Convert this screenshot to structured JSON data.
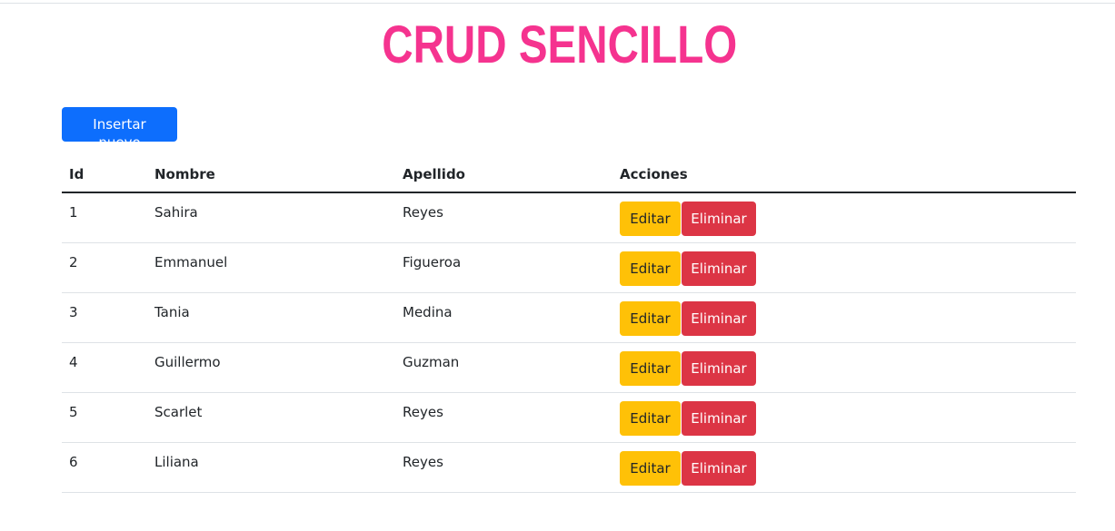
{
  "title": "CRUD SENCILLO",
  "colors": {
    "title": "#f5338f",
    "primary": "#0d6efd",
    "warning": "#ffc107",
    "danger": "#dc3545"
  },
  "insert_button": "Insertar nuevo",
  "table": {
    "headers": {
      "id": "Id",
      "nombre": "Nombre",
      "apellido": "Apellido",
      "acciones": "Acciones"
    },
    "edit_label": "Editar",
    "delete_label": "Eliminar",
    "rows": [
      {
        "id": "1",
        "nombre": "Sahira",
        "apellido": "Reyes"
      },
      {
        "id": "2",
        "nombre": "Emmanuel",
        "apellido": "Figueroa"
      },
      {
        "id": "3",
        "nombre": "Tania",
        "apellido": "Medina"
      },
      {
        "id": "4",
        "nombre": "Guillermo",
        "apellido": "Guzman"
      },
      {
        "id": "5",
        "nombre": "Scarlet",
        "apellido": "Reyes"
      },
      {
        "id": "6",
        "nombre": "Liliana",
        "apellido": "Reyes"
      }
    ]
  }
}
